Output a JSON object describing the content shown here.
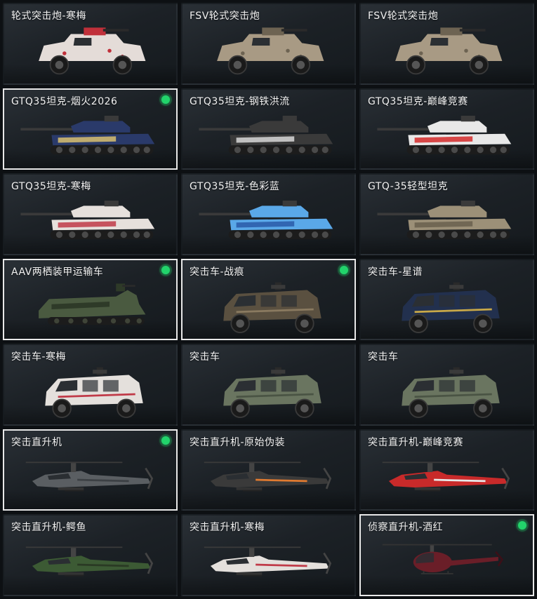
{
  "colors": {
    "equipped_dot": "#22d36b",
    "selected_border": "#e8e8e8"
  },
  "items": [
    {
      "label": "轮式突击炮-寒梅",
      "type": "armored-car",
      "color": "#e4dcd8",
      "accent": "#c0303a",
      "selected": false,
      "equipped": false
    },
    {
      "label": "FSV轮式突击炮",
      "type": "armored-car",
      "color": "#a89a84",
      "accent": "#6d6352",
      "selected": false,
      "equipped": false
    },
    {
      "label": "FSV轮式突击炮",
      "type": "armored-car",
      "color": "#a89a84",
      "accent": "#6d6352",
      "selected": false,
      "equipped": false
    },
    {
      "label": "GTQ35坦克-烟火2026",
      "type": "tank",
      "color": "#2a3a6a",
      "accent": "#d8c070",
      "selected": true,
      "equipped": true
    },
    {
      "label": "GTQ35坦克-钢铁洪流",
      "type": "tank",
      "color": "#3a3a3a",
      "accent": "#d8d8d8",
      "selected": false,
      "equipped": false
    },
    {
      "label": "GTQ35坦克-巅峰竞赛",
      "type": "tank",
      "color": "#e8e8e8",
      "accent": "#d42a2a",
      "selected": false,
      "equipped": false
    },
    {
      "label": "GTQ35坦克-寒梅",
      "type": "tank",
      "color": "#e6e0dc",
      "accent": "#c03a48",
      "selected": false,
      "equipped": false
    },
    {
      "label": "GTQ35坦克-色彩蓝",
      "type": "tank",
      "color": "#5aa8e8",
      "accent": "#2a5aa8",
      "selected": false,
      "equipped": false
    },
    {
      "label": "GTQ-35轻型坦克",
      "type": "tank",
      "color": "#9c9078",
      "accent": "#6a604e",
      "selected": false,
      "equipped": false
    },
    {
      "label": "AAV两栖装甲运输车",
      "type": "amphibious",
      "color": "#4a5a40",
      "accent": "#2e3a28",
      "selected": true,
      "equipped": true
    },
    {
      "label": "突击车-战痕",
      "type": "mrap",
      "color": "#5a5040",
      "accent": "#8a7a60",
      "selected": true,
      "equipped": true
    },
    {
      "label": "突击车-星谱",
      "type": "mrap",
      "color": "#22304e",
      "accent": "#c8a848",
      "selected": false,
      "equipped": false
    },
    {
      "label": "突击车-寒梅",
      "type": "mrap",
      "color": "#e4e0dc",
      "accent": "#c03a48",
      "selected": false,
      "equipped": false
    },
    {
      "label": "突击车",
      "type": "mrap",
      "color": "#6a7560",
      "accent": "#4a5444",
      "selected": false,
      "equipped": false
    },
    {
      "label": "突击车",
      "type": "mrap",
      "color": "#6a7560",
      "accent": "#4a5444",
      "selected": false,
      "equipped": false
    },
    {
      "label": "突击直升机",
      "type": "helicopter",
      "color": "#5a5e62",
      "accent": "#3c4044",
      "selected": true,
      "equipped": true
    },
    {
      "label": "突击直升机-原始伪装",
      "type": "helicopter",
      "color": "#3a3a3a",
      "accent": "#e07a30",
      "selected": false,
      "equipped": false
    },
    {
      "label": "突击直升机-巅峰竞赛",
      "type": "helicopter",
      "color": "#c82a2a",
      "accent": "#e8e8e8",
      "selected": false,
      "equipped": false
    },
    {
      "label": "突击直升机-鳄鱼",
      "type": "helicopter",
      "color": "#3c5a34",
      "accent": "#2a3a24",
      "selected": false,
      "equipped": false
    },
    {
      "label": "突击直升机-寒梅",
      "type": "helicopter",
      "color": "#e4e0dc",
      "accent": "#c03a48",
      "selected": false,
      "equipped": false
    },
    {
      "label": "侦察直升机-酒红",
      "type": "scout-heli",
      "color": "#6a1e28",
      "accent": "#3a1018",
      "selected": true,
      "equipped": true
    }
  ]
}
